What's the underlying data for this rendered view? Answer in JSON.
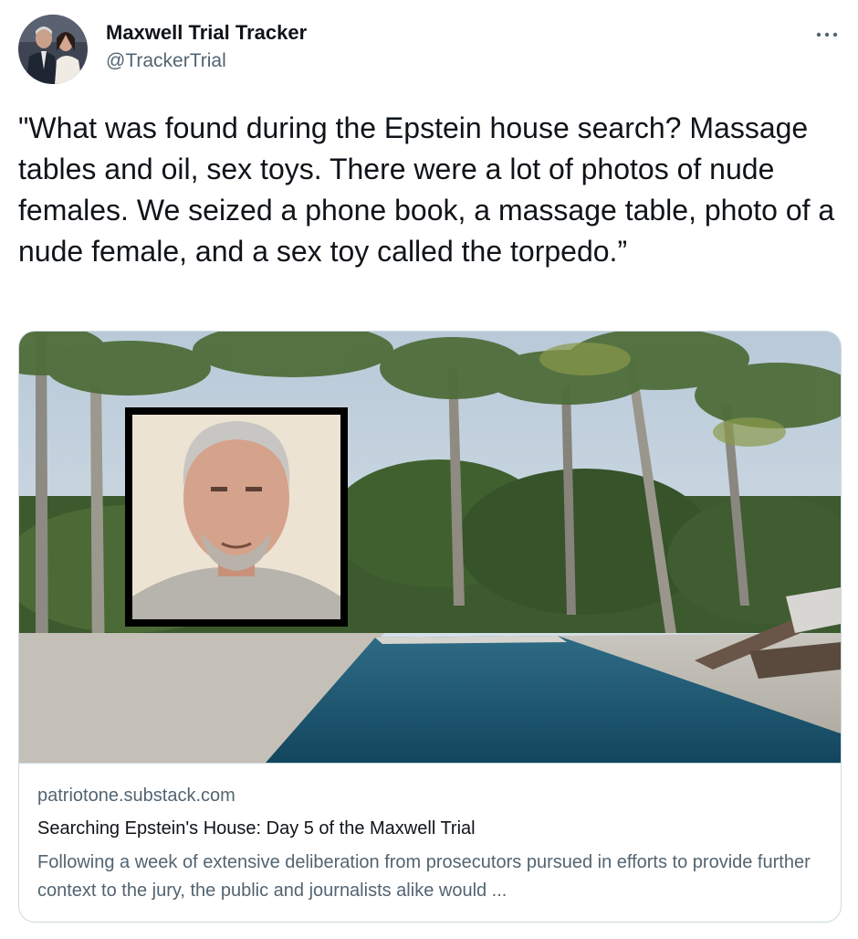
{
  "author": {
    "display_name": "Maxwell Trial Tracker",
    "handle": "@TrackerTrial",
    "avatar_icon": "profile-photo"
  },
  "more_icon": "ellipsis-icon",
  "tweet": {
    "text": "\"What was found during the Epstein house search? Massage tables and oil, sex toys. There were a lot of photos of nude females. We seized a phone book, a massage table, photo of a nude female, and a sex toy called the torpedo.”"
  },
  "link_card": {
    "domain": "patriotone.substack.com",
    "title": "Searching Epstein's House: Day 5 of the Maxwell Trial",
    "description": "Following a week of extensive deliberation from prosecutors pursued in efforts to provide further context to the jury, the public and journalists alike would ...",
    "image_icon": "article-thumbnail"
  },
  "colors": {
    "text_primary": "#0f1419",
    "text_secondary": "#536471",
    "border": "#cfd9de"
  }
}
